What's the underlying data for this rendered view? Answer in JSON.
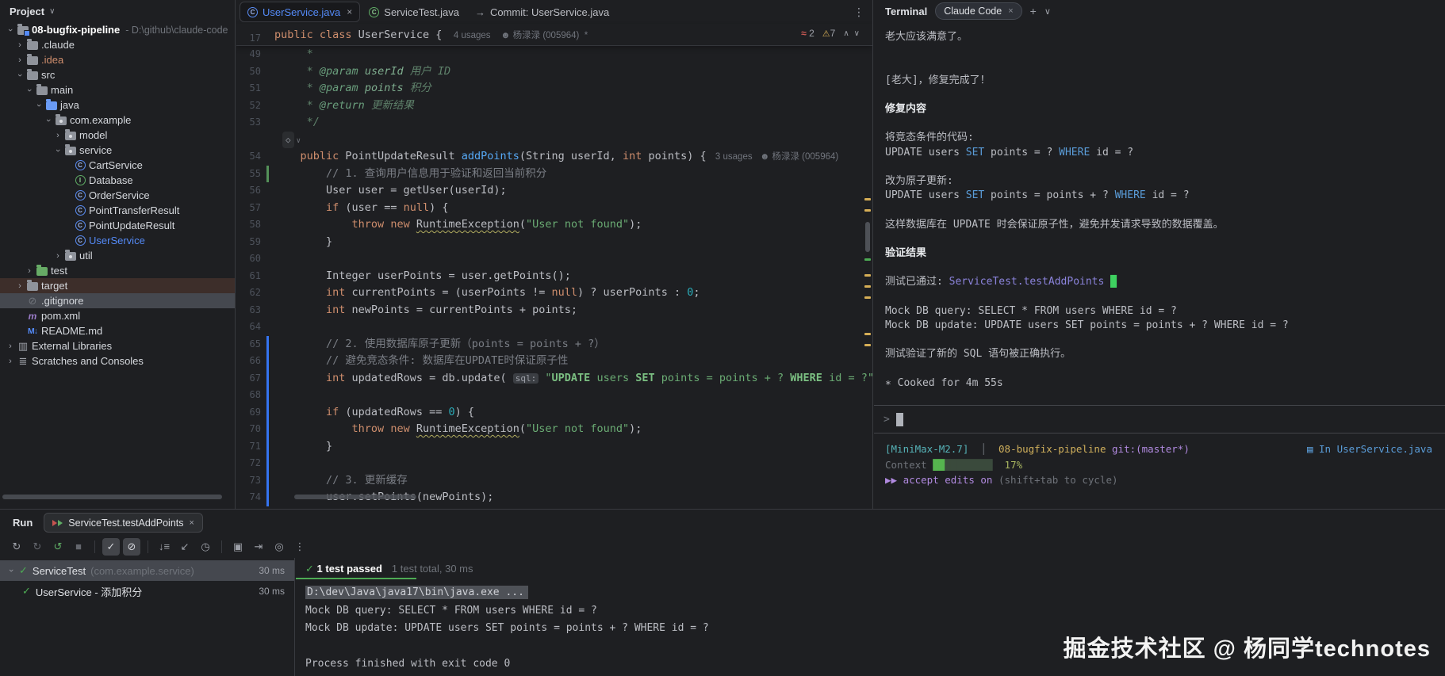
{
  "project_panel": {
    "header": "Project",
    "tree": [
      {
        "lvl": 0,
        "chev": "open",
        "icon": "folder-root",
        "name": "08-bugfix-pipeline",
        "bold": true,
        "extra": "- D:\\github\\claude-code"
      },
      {
        "lvl": 1,
        "chev": "closed",
        "icon": "folder",
        "name": ".claude"
      },
      {
        "lvl": 1,
        "chev": "closed",
        "icon": "folder",
        "name": ".idea",
        "cls": "orange"
      },
      {
        "lvl": 1,
        "chev": "open",
        "icon": "folder",
        "name": "src"
      },
      {
        "lvl": 2,
        "chev": "open",
        "icon": "folder",
        "name": "main"
      },
      {
        "lvl": 3,
        "chev": "open",
        "icon": "folder-blue",
        "name": "java"
      },
      {
        "lvl": 4,
        "chev": "open",
        "icon": "pkg",
        "name": "com.example"
      },
      {
        "lvl": 5,
        "chev": "closed",
        "icon": "pkg",
        "name": "model"
      },
      {
        "lvl": 5,
        "chev": "open",
        "icon": "pkg",
        "name": "service"
      },
      {
        "lvl": 6,
        "chev": "",
        "icon": "class",
        "name": "CartService"
      },
      {
        "lvl": 6,
        "chev": "",
        "icon": "interface",
        "name": "Database"
      },
      {
        "lvl": 6,
        "chev": "",
        "icon": "class",
        "name": "OrderService"
      },
      {
        "lvl": 6,
        "chev": "",
        "icon": "class",
        "name": "PointTransferResult"
      },
      {
        "lvl": 6,
        "chev": "",
        "icon": "class",
        "name": "PointUpdateResult"
      },
      {
        "lvl": 6,
        "chev": "",
        "icon": "class",
        "name": "UserService",
        "cls": "blue"
      },
      {
        "lvl": 5,
        "chev": "closed",
        "icon": "pkg",
        "name": "util"
      },
      {
        "lvl": 2,
        "chev": "closed",
        "icon": "folder-green",
        "name": "test"
      },
      {
        "lvl": 1,
        "chev": "closed",
        "icon": "folder",
        "name": "target",
        "row": "target"
      },
      {
        "lvl": 1,
        "chev": "",
        "icon": "ignored",
        "name": ".gitignore",
        "row": "sel"
      },
      {
        "lvl": 1,
        "chev": "",
        "icon": "maven",
        "name": "pom.xml"
      },
      {
        "lvl": 1,
        "chev": "",
        "icon": "markdown",
        "name": "README.md"
      },
      {
        "lvl": 0,
        "chev": "closed",
        "icon": "lib",
        "name": "External Libraries"
      },
      {
        "lvl": 0,
        "chev": "closed",
        "icon": "scratch",
        "name": "Scratches and Consoles"
      }
    ]
  },
  "editor": {
    "tabs": [
      {
        "label": "UserService.java",
        "icon": "class",
        "active": true,
        "close": "×"
      },
      {
        "label": "ServiceTest.java",
        "icon": "test",
        "active": false,
        "close": ""
      },
      {
        "label": "Commit: UserService.java",
        "icon": "arrow",
        "active": false,
        "close": ""
      }
    ],
    "kebab": "⋮",
    "inspections": {
      "typo_icon": "≈",
      "typos": "2",
      "warn_icon": "⚠",
      "warnings": "7",
      "up": "∧",
      "down": "∨"
    },
    "sticky": {
      "n": "17",
      "s": [
        [
          "public class ",
          "k"
        ],
        [
          "UserService",
          ""
        ],
        [
          " { ",
          ""
        ],
        [
          "  4 usages",
          "an"
        ],
        [
          "    ☻ 杨渌渌 (005964)",
          "an"
        ],
        [
          "  *",
          "an"
        ]
      ]
    },
    "lines": [
      {
        "n": "49",
        "s": [
          [
            "     *",
            "dc"
          ]
        ]
      },
      {
        "n": "50",
        "s": [
          [
            "     * ",
            "dc"
          ],
          [
            "@param ",
            "dt"
          ],
          [
            "userId ",
            "dt2"
          ],
          [
            "用户 ID",
            "dc"
          ]
        ]
      },
      {
        "n": "51",
        "s": [
          [
            "     * ",
            "dc"
          ],
          [
            "@param ",
            "dt"
          ],
          [
            "points ",
            "dt2"
          ],
          [
            "积分",
            "dc"
          ]
        ]
      },
      {
        "n": "52",
        "s": [
          [
            "     * ",
            "dc"
          ],
          [
            "@return ",
            "dt"
          ],
          [
            "更新结果",
            "dc"
          ]
        ]
      },
      {
        "n": "53",
        "s": [
          [
            "     */",
            "dc"
          ]
        ]
      },
      {
        "n": "",
        "icon": true,
        "s": []
      },
      {
        "n": "54",
        "s": [
          [
            "    ",
            ""
          ],
          [
            "public ",
            "k"
          ],
          [
            "PointUpdateResult ",
            ""
          ],
          [
            "addPoints",
            "m"
          ],
          [
            "(String userId, ",
            ""
          ],
          [
            "int",
            "k"
          ],
          [
            " points) { ",
            ""
          ],
          [
            " 3 usages",
            "an"
          ],
          [
            "   ☻ 杨渌渌 (005964)",
            "an"
          ]
        ]
      },
      {
        "n": "55",
        "g": "green",
        "s": [
          [
            "        ",
            ""
          ],
          [
            "// 1. 查询用户信息用于验证和返回当前积分",
            "c"
          ]
        ]
      },
      {
        "n": "56",
        "s": [
          [
            "        User user = getUser(userId);",
            ""
          ]
        ]
      },
      {
        "n": "57",
        "s": [
          [
            "        ",
            ""
          ],
          [
            "if",
            "k"
          ],
          [
            " (user == ",
            ""
          ],
          [
            "null",
            "k"
          ],
          [
            ") {",
            ""
          ]
        ]
      },
      {
        "n": "58",
        "s": [
          [
            "            ",
            ""
          ],
          [
            "throw",
            "k"
          ],
          [
            " ",
            ""
          ],
          [
            "new",
            "k"
          ],
          [
            " ",
            ""
          ],
          [
            "RuntimeException",
            "w"
          ],
          [
            "(",
            ""
          ],
          [
            "\"User not found\"",
            "s"
          ],
          [
            ");",
            ""
          ]
        ]
      },
      {
        "n": "59",
        "s": [
          [
            "        }",
            ""
          ]
        ]
      },
      {
        "n": "60",
        "s": []
      },
      {
        "n": "61",
        "s": [
          [
            "        Integer userPoints = user.getPoints();",
            ""
          ]
        ]
      },
      {
        "n": "62",
        "s": [
          [
            "        ",
            ""
          ],
          [
            "int",
            "k"
          ],
          [
            " currentPoints = (userPoints != ",
            ""
          ],
          [
            "null",
            "k"
          ],
          [
            ") ? userPoints : ",
            ""
          ],
          [
            "0",
            "n"
          ],
          [
            ";",
            ""
          ]
        ]
      },
      {
        "n": "63",
        "s": [
          [
            "        ",
            ""
          ],
          [
            "int",
            "k"
          ],
          [
            " newPoints = currentPoints + points;",
            ""
          ]
        ]
      },
      {
        "n": "64",
        "s": []
      },
      {
        "n": "65",
        "g": "blue",
        "s": [
          [
            "        ",
            ""
          ],
          [
            "// 2. 使用数据库原子更新（points = points + ?）",
            "c"
          ]
        ]
      },
      {
        "n": "66",
        "g": "blue",
        "s": [
          [
            "        ",
            ""
          ],
          [
            "// 避免竞态条件: 数据库在UPDATE时保证原子性",
            "c"
          ]
        ]
      },
      {
        "n": "67",
        "g": "blue",
        "s": [
          [
            "        ",
            ""
          ],
          [
            "int",
            "k"
          ],
          [
            " updatedRows = db.update( ",
            ""
          ],
          [
            "sql:",
            "bdg"
          ],
          [
            " ",
            ""
          ],
          [
            "\"",
            "s"
          ],
          [
            "UPDATE",
            "sk"
          ],
          [
            " users ",
            "s"
          ],
          [
            "SET",
            "sk"
          ],
          [
            " points = points + ? ",
            "s"
          ],
          [
            "WHERE",
            "sk"
          ],
          [
            " id = ?\");",
            "s"
          ]
        ]
      },
      {
        "n": "68",
        "g": "blue",
        "s": []
      },
      {
        "n": "69",
        "g": "blue",
        "s": [
          [
            "        ",
            ""
          ],
          [
            "if",
            "k"
          ],
          [
            " (updatedRows == ",
            ""
          ],
          [
            "0",
            "n"
          ],
          [
            ") {",
            ""
          ]
        ]
      },
      {
        "n": "70",
        "g": "blue",
        "s": [
          [
            "            ",
            ""
          ],
          [
            "throw",
            "k"
          ],
          [
            " ",
            ""
          ],
          [
            "new",
            "k"
          ],
          [
            " ",
            ""
          ],
          [
            "RuntimeException",
            "w"
          ],
          [
            "(",
            ""
          ],
          [
            "\"User not found\"",
            "s"
          ],
          [
            ");",
            ""
          ]
        ]
      },
      {
        "n": "71",
        "g": "blue",
        "s": [
          [
            "        }",
            ""
          ]
        ]
      },
      {
        "n": "72",
        "g": "blue",
        "s": []
      },
      {
        "n": "73",
        "g": "blue",
        "s": [
          [
            "        ",
            ""
          ],
          [
            "// 3. 更新缓存",
            "c"
          ]
        ]
      },
      {
        "n": "74",
        "g": "blue",
        "s": [
          [
            "        user.setPoints(newPoints);",
            ""
          ]
        ]
      }
    ]
  },
  "terminal": {
    "panel_label": "Terminal",
    "tab": {
      "label": "Claude Code",
      "close": "×"
    },
    "plus": "+",
    "chevron": "∨",
    "lines": [
      {
        "s": [
          [
            "老大应该满意了。",
            ""
          ]
        ]
      },
      {
        "s": []
      },
      {
        "s": []
      },
      {
        "s": [
          [
            "[老大]，修复完成了！",
            ""
          ]
        ]
      },
      {
        "s": []
      },
      {
        "s": [
          [
            "修复内容",
            "b"
          ]
        ]
      },
      {
        "s": []
      },
      {
        "s": [
          [
            "将竞态条件的代码:",
            ""
          ]
        ]
      },
      {
        "s": [
          [
            "UPDATE users ",
            ""
          ],
          [
            "SET",
            "bl"
          ],
          [
            " points = ? ",
            ""
          ],
          [
            "WHERE",
            "bl"
          ],
          [
            " id = ?",
            ""
          ]
        ]
      },
      {
        "s": []
      },
      {
        "s": [
          [
            "改为原子更新:",
            ""
          ]
        ]
      },
      {
        "s": [
          [
            "UPDATE users ",
            ""
          ],
          [
            "SET",
            "bl"
          ],
          [
            " points = points + ? ",
            ""
          ],
          [
            "WHERE",
            "bl"
          ],
          [
            " id = ?",
            ""
          ]
        ]
      },
      {
        "s": []
      },
      {
        "s": [
          [
            "这样数据库在 UPDATE 时会保证原子性，避免并发请求导致的数据覆盖。",
            ""
          ]
        ]
      },
      {
        "s": []
      },
      {
        "s": [
          [
            "验证结果",
            "b"
          ]
        ]
      },
      {
        "s": []
      },
      {
        "s": [
          [
            "测试已通过: ",
            ""
          ],
          [
            "ServiceTest.testAddPoints",
            "vi"
          ],
          [
            " ",
            ""
          ],
          [
            "█",
            "cur"
          ]
        ]
      },
      {
        "s": []
      },
      {
        "s": [
          [
            "Mock DB query: SELECT * FROM users WHERE id = ?",
            ""
          ]
        ]
      },
      {
        "s": [
          [
            "Mock DB update: UPDATE users SET points = points + ? WHERE id = ?",
            ""
          ]
        ]
      },
      {
        "s": []
      },
      {
        "s": [
          [
            "测试验证了新的 SQL 语句被正确执行。",
            ""
          ]
        ]
      },
      {
        "s": []
      },
      {
        "s": [
          [
            "∗ Cooked for 4m 55s",
            ""
          ]
        ]
      }
    ],
    "prompt_symbol": ">",
    "status": {
      "left": [
        [
          "[MiniMax-M2.7]",
          "te"
        ],
        [
          "  ",
          "dim"
        ],
        [
          "│",
          "dim"
        ],
        [
          "  ",
          "dim"
        ],
        [
          "08-bugfix-pipeline",
          "ye"
        ],
        [
          " ",
          ""
        ],
        [
          "git:(master*)",
          "vio"
        ]
      ],
      "right": [
        [
          "▤ ",
          "bl"
        ],
        [
          "In UserService.java",
          "bl"
        ]
      ],
      "context": [
        [
          "Context ",
          "dim"
        ],
        [
          "██",
          "ctxon"
        ],
        [
          "████████",
          "ctxoff"
        ],
        [
          "  17%",
          "gr2"
        ]
      ],
      "mode": [
        [
          "▶▶ ",
          "vio"
        ],
        [
          "accept edits on ",
          "vio"
        ],
        [
          "(shift+tab to cycle)",
          "dim"
        ]
      ]
    }
  },
  "run_panel": {
    "label": "Run",
    "tab": {
      "label": "ServiceTest.testAddPoints",
      "close": "×"
    },
    "toolbar": [
      {
        "name": "rerun",
        "g": "↻"
      },
      {
        "name": "rerun-failed",
        "g": "↻",
        "dim": true
      },
      {
        "name": "toggle-auto-test",
        "g": "↺",
        "green": true
      },
      {
        "name": "stop",
        "g": "■",
        "dim": true
      },
      {
        "sep": true
      },
      {
        "name": "show-passed",
        "g": "✓",
        "toggled": true
      },
      {
        "name": "show-ignored",
        "g": "⊘",
        "toggled": true
      },
      {
        "sep": true
      },
      {
        "name": "sort-alphabetically",
        "g": "↓≡"
      },
      {
        "name": "expand-all",
        "g": "↙"
      },
      {
        "name": "sort-by-duration",
        "g": "◷"
      },
      {
        "sep": true
      },
      {
        "name": "snapshot",
        "g": "▣"
      },
      {
        "name": "import-tests",
        "g": "⇥"
      },
      {
        "name": "coverage",
        "g": "◎"
      },
      {
        "name": "more-options",
        "g": "⋮"
      }
    ],
    "tests": [
      {
        "chev": "open",
        "check": "✓",
        "name": "ServiceTest",
        "pkg": "(com.example.service)",
        "time": "30 ms",
        "selected": true
      },
      {
        "check": "✓",
        "name": "UserService - 添加积分",
        "pkg": "",
        "time": "30 ms",
        "child": true
      }
    ],
    "summary": {
      "check": "✓",
      "passed": "1 test passed",
      "detail": "1 test total, 30 ms"
    },
    "console": [
      {
        "t": "D:\\dev\\Java\\java17\\bin\\java.exe ...",
        "cmd": true
      },
      {
        "t": "Mock DB query: SELECT * FROM users WHERE id = ?"
      },
      {
        "t": "Mock DB update: UPDATE users SET points = points + ? WHERE id = ?"
      },
      {
        "t": ""
      },
      {
        "t": "Process finished with exit code 0"
      }
    ]
  },
  "watermark": "掘金技术社区 @ 杨同学technotes"
}
